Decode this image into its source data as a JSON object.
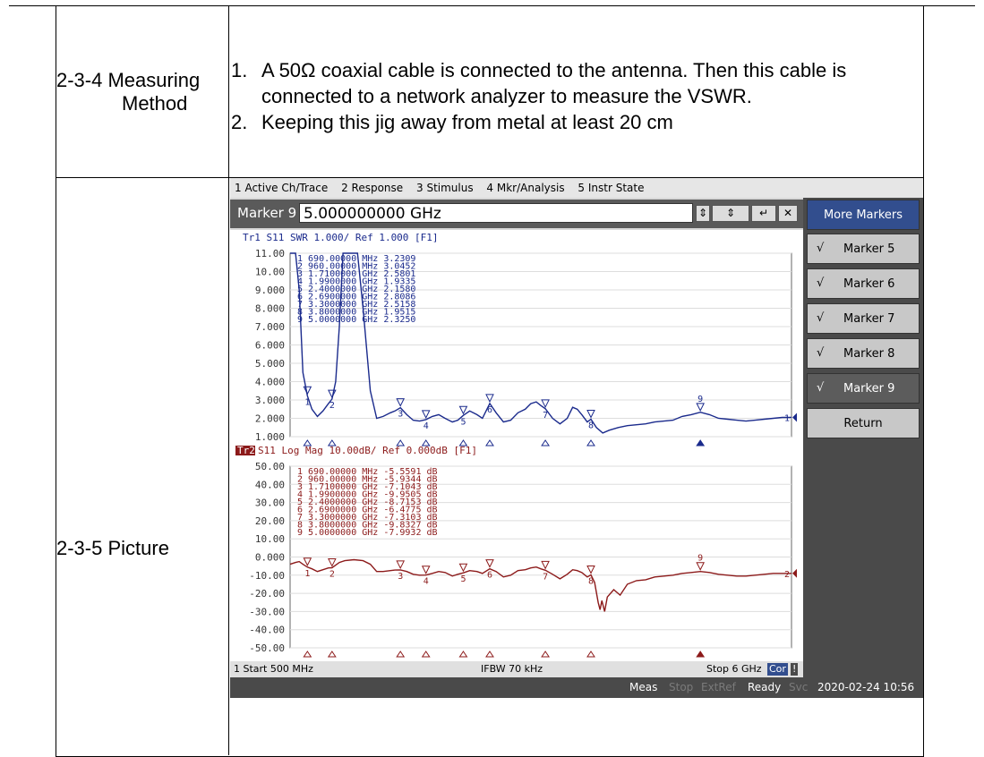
{
  "doc": {
    "measuring_label_1": "2-3-4 Measuring",
    "measuring_label_2": "Method",
    "step1_num": "1.",
    "step1_line1": "A 50Ω coaxial cable is connected to the antenna. Then this cable is",
    "step1_line2": "connected to a network analyzer to measure the VSWR.",
    "step2_num": "2.",
    "step2_line1": "Keeping this jig away from metal at least 20 cm",
    "picture_label": "2-3-5 Picture"
  },
  "analyzer": {
    "menu": [
      "1 Active Ch/Trace",
      "2 Response",
      "3 Stimulus",
      "4 Mkr/Analysis",
      "5 Instr State"
    ],
    "entry_label": "Marker 9",
    "entry_value": "5.000000000 GHz",
    "softkeys": {
      "title": "More Markers",
      "items": [
        {
          "check": "√",
          "label": "Marker 5"
        },
        {
          "check": "√",
          "label": "Marker 6"
        },
        {
          "check": "√",
          "label": "Marker 7"
        },
        {
          "check": "√",
          "label": "Marker 8"
        },
        {
          "check": "√",
          "label": "Marker 9"
        }
      ],
      "return": "Return"
    },
    "status": {
      "start": "1 Start 500 MHz",
      "ifbw": "IFBW 70 kHz",
      "stop": "Stop 6 GHz",
      "cor": "Cor",
      "bang": "!"
    },
    "bottom": {
      "meas": "Meas",
      "stop": "Stop",
      "extref": "ExtRef",
      "ready": "Ready",
      "svc": "Svc",
      "datetime": "2020-02-24 10:56"
    },
    "colors": {
      "trace1": "#1a2a8c",
      "trace2": "#8c1a1a",
      "softkey_head": "#324e8e"
    }
  },
  "chart_data": [
    {
      "type": "line",
      "title": "Tr1 S11 SWR 1.000/ Ref 1.000 [F1]",
      "yticks": [
        "11.00",
        "10.00",
        "9.000",
        "8.000",
        "7.000",
        "6.000",
        "5.000",
        "4.000",
        "3.000",
        "2.000",
        "1.000"
      ],
      "ylim": [
        1,
        11
      ],
      "xlim": [
        500,
        6000
      ],
      "x_unit": "MHz",
      "markers": [
        {
          "n": "1",
          "freq": "690.00000 MHz",
          "value": "3.2309",
          "x": 690,
          "y": 3.2309
        },
        {
          "n": "2",
          "freq": "960.00000 MHz",
          "value": "3.0452",
          "x": 960,
          "y": 3.0452
        },
        {
          "n": "3",
          "freq": "1.7100000 GHz",
          "value": "2.5801",
          "x": 1710,
          "y": 2.5801
        },
        {
          "n": "4",
          "freq": "1.9900000 GHz",
          "value": "1.9335",
          "x": 1990,
          "y": 1.9335
        },
        {
          "n": "5",
          "freq": "2.4000000 GHz",
          "value": "2.1580",
          "x": 2400,
          "y": 2.158
        },
        {
          "n": "6",
          "freq": "2.6900000 GHz",
          "value": "2.8086",
          "x": 2690,
          "y": 2.8086
        },
        {
          "n": "7",
          "freq": "3.3000000 GHz",
          "value": "2.5158",
          "x": 3300,
          "y": 2.5158
        },
        {
          "n": "8",
          "freq": "3.8000000 GHz",
          "value": "1.9515",
          "x": 3800,
          "y": 1.9515
        },
        {
          "n": "9",
          "freq": "5.0000000 GHz",
          "value": "2.3250",
          "x": 5000,
          "y": 2.325
        }
      ],
      "trace": [
        [
          500,
          11
        ],
        [
          560,
          11
        ],
        [
          600,
          9
        ],
        [
          640,
          4.5
        ],
        [
          690,
          3.23
        ],
        [
          740,
          2.5
        ],
        [
          800,
          2.1
        ],
        [
          860,
          2.4
        ],
        [
          920,
          2.8
        ],
        [
          960,
          3.05
        ],
        [
          1000,
          4
        ],
        [
          1040,
          7
        ],
        [
          1080,
          11
        ],
        [
          1160,
          11
        ],
        [
          1240,
          11
        ],
        [
          1300,
          8
        ],
        [
          1380,
          3.5
        ],
        [
          1450,
          2.0
        ],
        [
          1520,
          2.1
        ],
        [
          1600,
          2.3
        ],
        [
          1650,
          2.4
        ],
        [
          1710,
          2.58
        ],
        [
          1780,
          2.2
        ],
        [
          1850,
          1.9
        ],
        [
          1920,
          1.85
        ],
        [
          1990,
          1.93
        ],
        [
          2060,
          2.1
        ],
        [
          2130,
          2.2
        ],
        [
          2200,
          2.0
        ],
        [
          2280,
          1.8
        ],
        [
          2340,
          1.9
        ],
        [
          2400,
          2.16
        ],
        [
          2470,
          2.4
        ],
        [
          2550,
          2.2
        ],
        [
          2610,
          2.0
        ],
        [
          2690,
          2.81
        ],
        [
          2760,
          2.3
        ],
        [
          2840,
          1.8
        ],
        [
          2920,
          1.9
        ],
        [
          3000,
          2.3
        ],
        [
          3080,
          2.5
        ],
        [
          3140,
          2.8
        ],
        [
          3200,
          2.9
        ],
        [
          3250,
          2.7
        ],
        [
          3300,
          2.52
        ],
        [
          3380,
          2.0
        ],
        [
          3460,
          1.7
        ],
        [
          3540,
          2.0
        ],
        [
          3600,
          2.6
        ],
        [
          3650,
          2.5
        ],
        [
          3700,
          2.2
        ],
        [
          3760,
          1.8
        ],
        [
          3800,
          1.95
        ],
        [
          3860,
          1.5
        ],
        [
          3930,
          1.2
        ],
        [
          4000,
          1.35
        ],
        [
          4100,
          1.5
        ],
        [
          4200,
          1.6
        ],
        [
          4300,
          1.65
        ],
        [
          4400,
          1.7
        ],
        [
          4500,
          1.8
        ],
        [
          4600,
          1.85
        ],
        [
          4700,
          1.9
        ],
        [
          4800,
          2.1
        ],
        [
          4900,
          2.2
        ],
        [
          5000,
          2.33
        ],
        [
          5100,
          2.2
        ],
        [
          5200,
          2.0
        ],
        [
          5300,
          1.95
        ],
        [
          5400,
          1.9
        ],
        [
          5500,
          1.85
        ],
        [
          5600,
          1.9
        ],
        [
          5700,
          1.95
        ],
        [
          5800,
          2.0
        ],
        [
          5900,
          2.05
        ],
        [
          6000,
          2.05
        ]
      ]
    },
    {
      "type": "line",
      "title": "S11 Log Mag 10.00dB/ Ref 0.000dB [F1]",
      "trace_label": "Tr2",
      "yticks": [
        "50.00",
        "40.00",
        "30.00",
        "20.00",
        "10.00",
        "0.000",
        "-10.00",
        "-20.00",
        "-30.00",
        "-40.00",
        "-50.00"
      ],
      "ylim": [
        -50,
        50
      ],
      "xlim": [
        500,
        6000
      ],
      "x_unit": "MHz",
      "markers": [
        {
          "n": "1",
          "freq": "690.00000 MHz",
          "value": "-5.5591 dB",
          "x": 690,
          "y": -5.5591
        },
        {
          "n": "2",
          "freq": "960.00000 MHz",
          "value": "-5.9344 dB",
          "x": 960,
          "y": -5.9344
        },
        {
          "n": "3",
          "freq": "1.7100000 GHz",
          "value": "-7.1043 dB",
          "x": 1710,
          "y": -7.1043
        },
        {
          "n": "4",
          "freq": "1.9900000 GHz",
          "value": "-9.9505 dB",
          "x": 1990,
          "y": -9.9505
        },
        {
          "n": "5",
          "freq": "2.4000000 GHz",
          "value": "-8.7153 dB",
          "x": 2400,
          "y": -8.7153
        },
        {
          "n": "6",
          "freq": "2.6900000 GHz",
          "value": "-6.4775 dB",
          "x": 2690,
          "y": -6.4775
        },
        {
          "n": "7",
          "freq": "3.3000000 GHz",
          "value": "-7.3103 dB",
          "x": 3300,
          "y": -7.3103
        },
        {
          "n": "8",
          "freq": "3.8000000 GHz",
          "value": "-9.8327 dB",
          "x": 3800,
          "y": -9.8327
        },
        {
          "n": "9",
          "freq": "5.0000000 GHz",
          "value": "-7.9932 dB",
          "x": 5000,
          "y": -7.9932
        }
      ],
      "trace": [
        [
          500,
          -4
        ],
        [
          560,
          -3
        ],
        [
          600,
          -2.5
        ],
        [
          640,
          -4
        ],
        [
          690,
          -5.56
        ],
        [
          740,
          -6.5
        ],
        [
          800,
          -8
        ],
        [
          860,
          -7
        ],
        [
          920,
          -6
        ],
        [
          960,
          -5.93
        ],
        [
          1000,
          -4.5
        ],
        [
          1040,
          -3
        ],
        [
          1100,
          -2
        ],
        [
          1200,
          -1.5
        ],
        [
          1300,
          -2
        ],
        [
          1380,
          -4
        ],
        [
          1450,
          -8
        ],
        [
          1520,
          -8
        ],
        [
          1600,
          -7.5
        ],
        [
          1650,
          -7.2
        ],
        [
          1710,
          -7.1
        ],
        [
          1780,
          -8
        ],
        [
          1850,
          -9.5
        ],
        [
          1920,
          -10
        ],
        [
          1990,
          -9.95
        ],
        [
          2060,
          -9
        ],
        [
          2130,
          -8
        ],
        [
          2200,
          -8.5
        ],
        [
          2280,
          -10.5
        ],
        [
          2340,
          -9.5
        ],
        [
          2400,
          -8.72
        ],
        [
          2470,
          -7.5
        ],
        [
          2550,
          -8
        ],
        [
          2610,
          -9
        ],
        [
          2690,
          -6.48
        ],
        [
          2760,
          -8
        ],
        [
          2840,
          -11
        ],
        [
          2920,
          -10
        ],
        [
          3000,
          -7.5
        ],
        [
          3080,
          -7
        ],
        [
          3140,
          -6
        ],
        [
          3200,
          -5.5
        ],
        [
          3250,
          -6.5
        ],
        [
          3300,
          -7.31
        ],
        [
          3380,
          -9.5
        ],
        [
          3460,
          -12
        ],
        [
          3540,
          -9.5
        ],
        [
          3600,
          -7
        ],
        [
          3650,
          -7.5
        ],
        [
          3700,
          -8.5
        ],
        [
          3760,
          -11
        ],
        [
          3800,
          -9.83
        ],
        [
          3840,
          -14
        ],
        [
          3880,
          -25
        ],
        [
          3900,
          -29
        ],
        [
          3920,
          -24
        ],
        [
          3950,
          -30
        ],
        [
          3980,
          -22
        ],
        [
          4050,
          -18
        ],
        [
          4120,
          -21
        ],
        [
          4200,
          -15
        ],
        [
          4300,
          -13
        ],
        [
          4400,
          -12.5
        ],
        [
          4500,
          -11
        ],
        [
          4600,
          -10.5
        ],
        [
          4700,
          -10
        ],
        [
          4800,
          -9
        ],
        [
          4900,
          -8.5
        ],
        [
          5000,
          -7.99
        ],
        [
          5100,
          -8.5
        ],
        [
          5200,
          -9.5
        ],
        [
          5300,
          -10
        ],
        [
          5400,
          -10.5
        ],
        [
          5500,
          -10.5
        ],
        [
          5600,
          -10
        ],
        [
          5700,
          -9.5
        ],
        [
          5800,
          -9
        ],
        [
          5900,
          -9
        ],
        [
          6000,
          -9
        ]
      ]
    }
  ]
}
